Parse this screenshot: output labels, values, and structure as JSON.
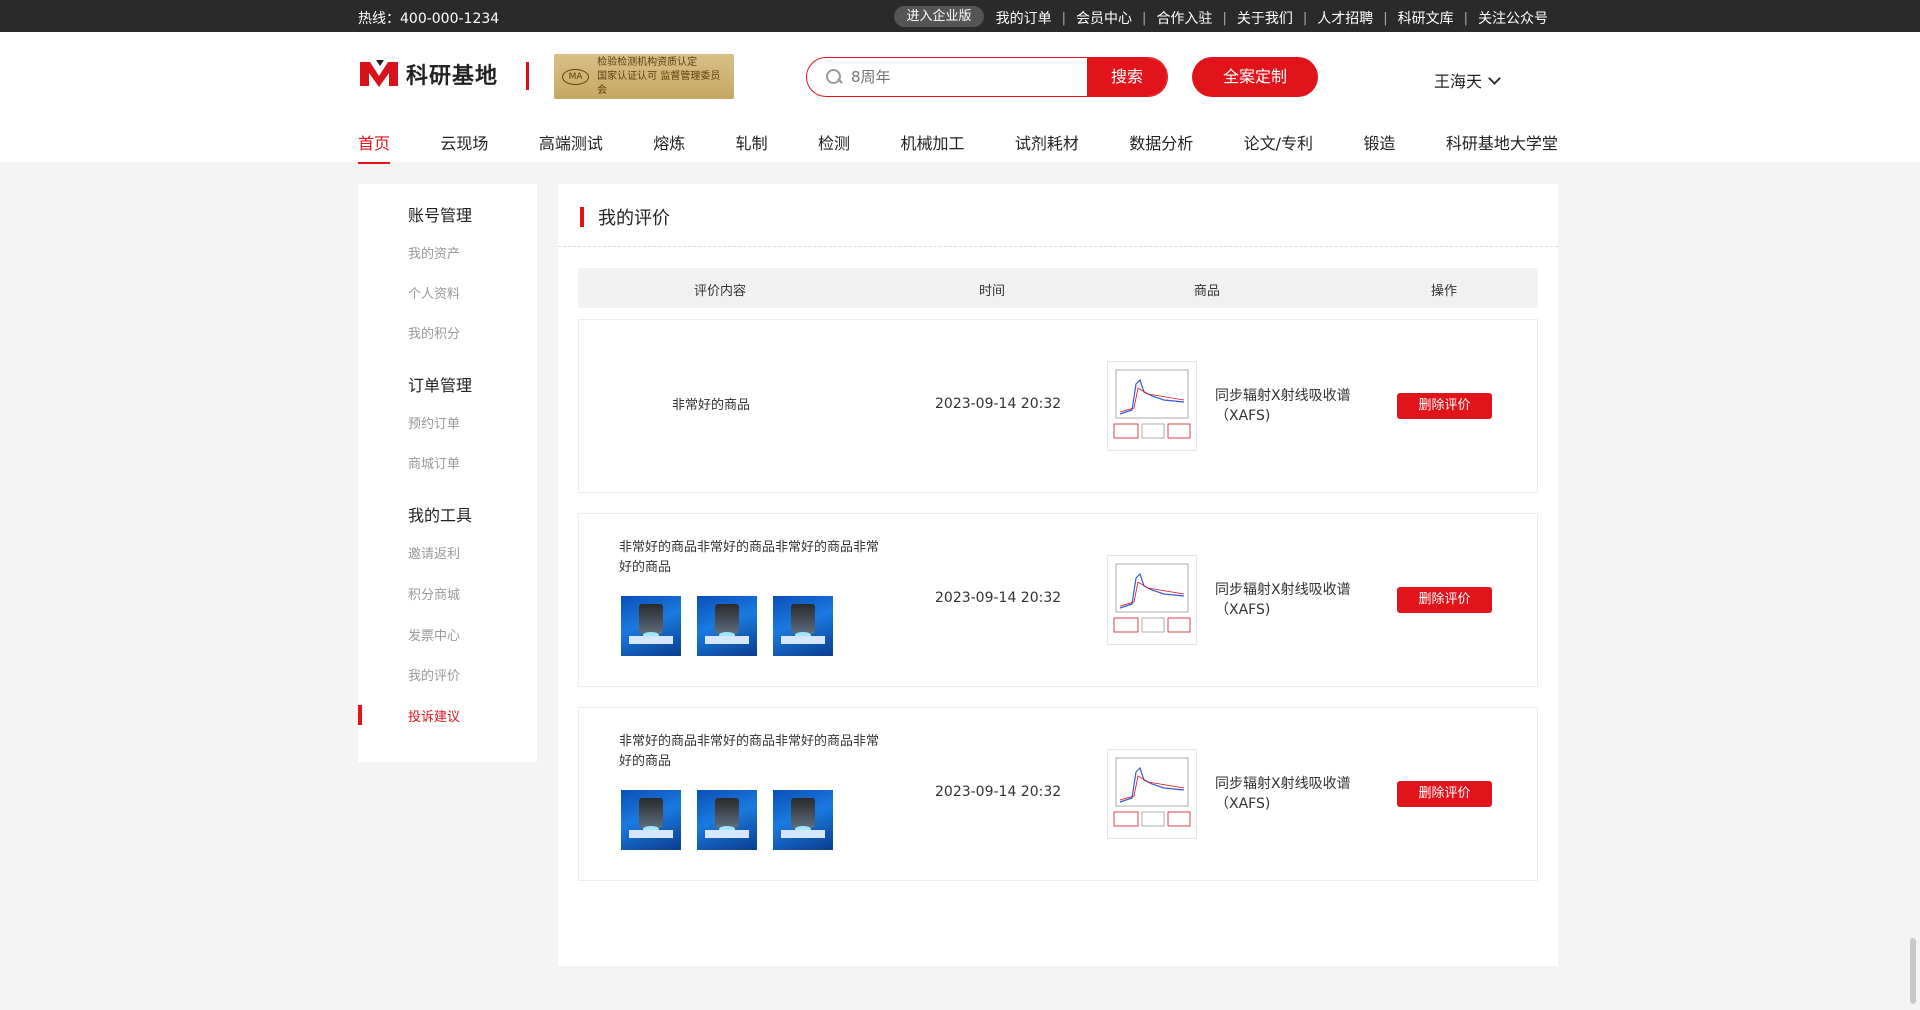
{
  "topbar": {
    "hotline": "热线：400-000-1234",
    "enterprise": "进入企业版",
    "links": [
      "我的订单",
      "会员中心",
      "合作入驻",
      "关于我们",
      "人才招聘",
      "科研文库",
      "关注公众号"
    ]
  },
  "header": {
    "logo_text": "科研基地",
    "cert_lines": [
      "检验检测机构资质认定",
      "国家认证认可 监督管理委员会"
    ],
    "cert_mark": "MA",
    "search_placeholder": "8周年",
    "search_button": "搜索",
    "custom_button": "全案定制",
    "user_name": "王海天"
  },
  "nav": {
    "items": [
      "首页",
      "云现场",
      "高端测试",
      "熔炼",
      "轧制",
      "检测",
      "机械加工",
      "试剂耗材",
      "数据分析",
      "论文/专利",
      "锻造",
      "科研基地大学堂"
    ],
    "active_index": 0
  },
  "sidebar": {
    "groups": [
      {
        "title": "账号管理",
        "items": [
          "我的资产",
          "个人资料",
          "我的积分"
        ]
      },
      {
        "title": "订单管理",
        "items": [
          "预约订单",
          "商城订单"
        ]
      },
      {
        "title": "我的工具",
        "items": [
          "邀请返利",
          "积分商城",
          "发票中心",
          "我的评价",
          "投诉建议"
        ]
      }
    ],
    "active_item": "投诉建议"
  },
  "main": {
    "title": "我的评价",
    "columns": [
      "评价内容",
      "时间",
      "商品",
      "操作"
    ],
    "rows": [
      {
        "content": "非常好的商品",
        "time": "2023-09-14  20:32",
        "product": "同步辐射X射线吸收谱（XAFS)",
        "action": "删除评价",
        "image_count": 0
      },
      {
        "content": "非常好的商品非常好的商品非常好的商品非常好的商品",
        "time": "2023-09-14  20:32",
        "product": "同步辐射X射线吸收谱（XAFS)",
        "action": "删除评价",
        "image_count": 3
      },
      {
        "content": "非常好的商品非常好的商品非常好的商品非常好的商品",
        "time": "2023-09-14  20:32",
        "product": "同步辐射X射线吸收谱（XAFS)",
        "action": "删除评价",
        "image_count": 3
      }
    ]
  },
  "colors": {
    "accent": "#e1141c",
    "topbar": "#2a2a2a",
    "page_bg": "#f4f4f4"
  }
}
